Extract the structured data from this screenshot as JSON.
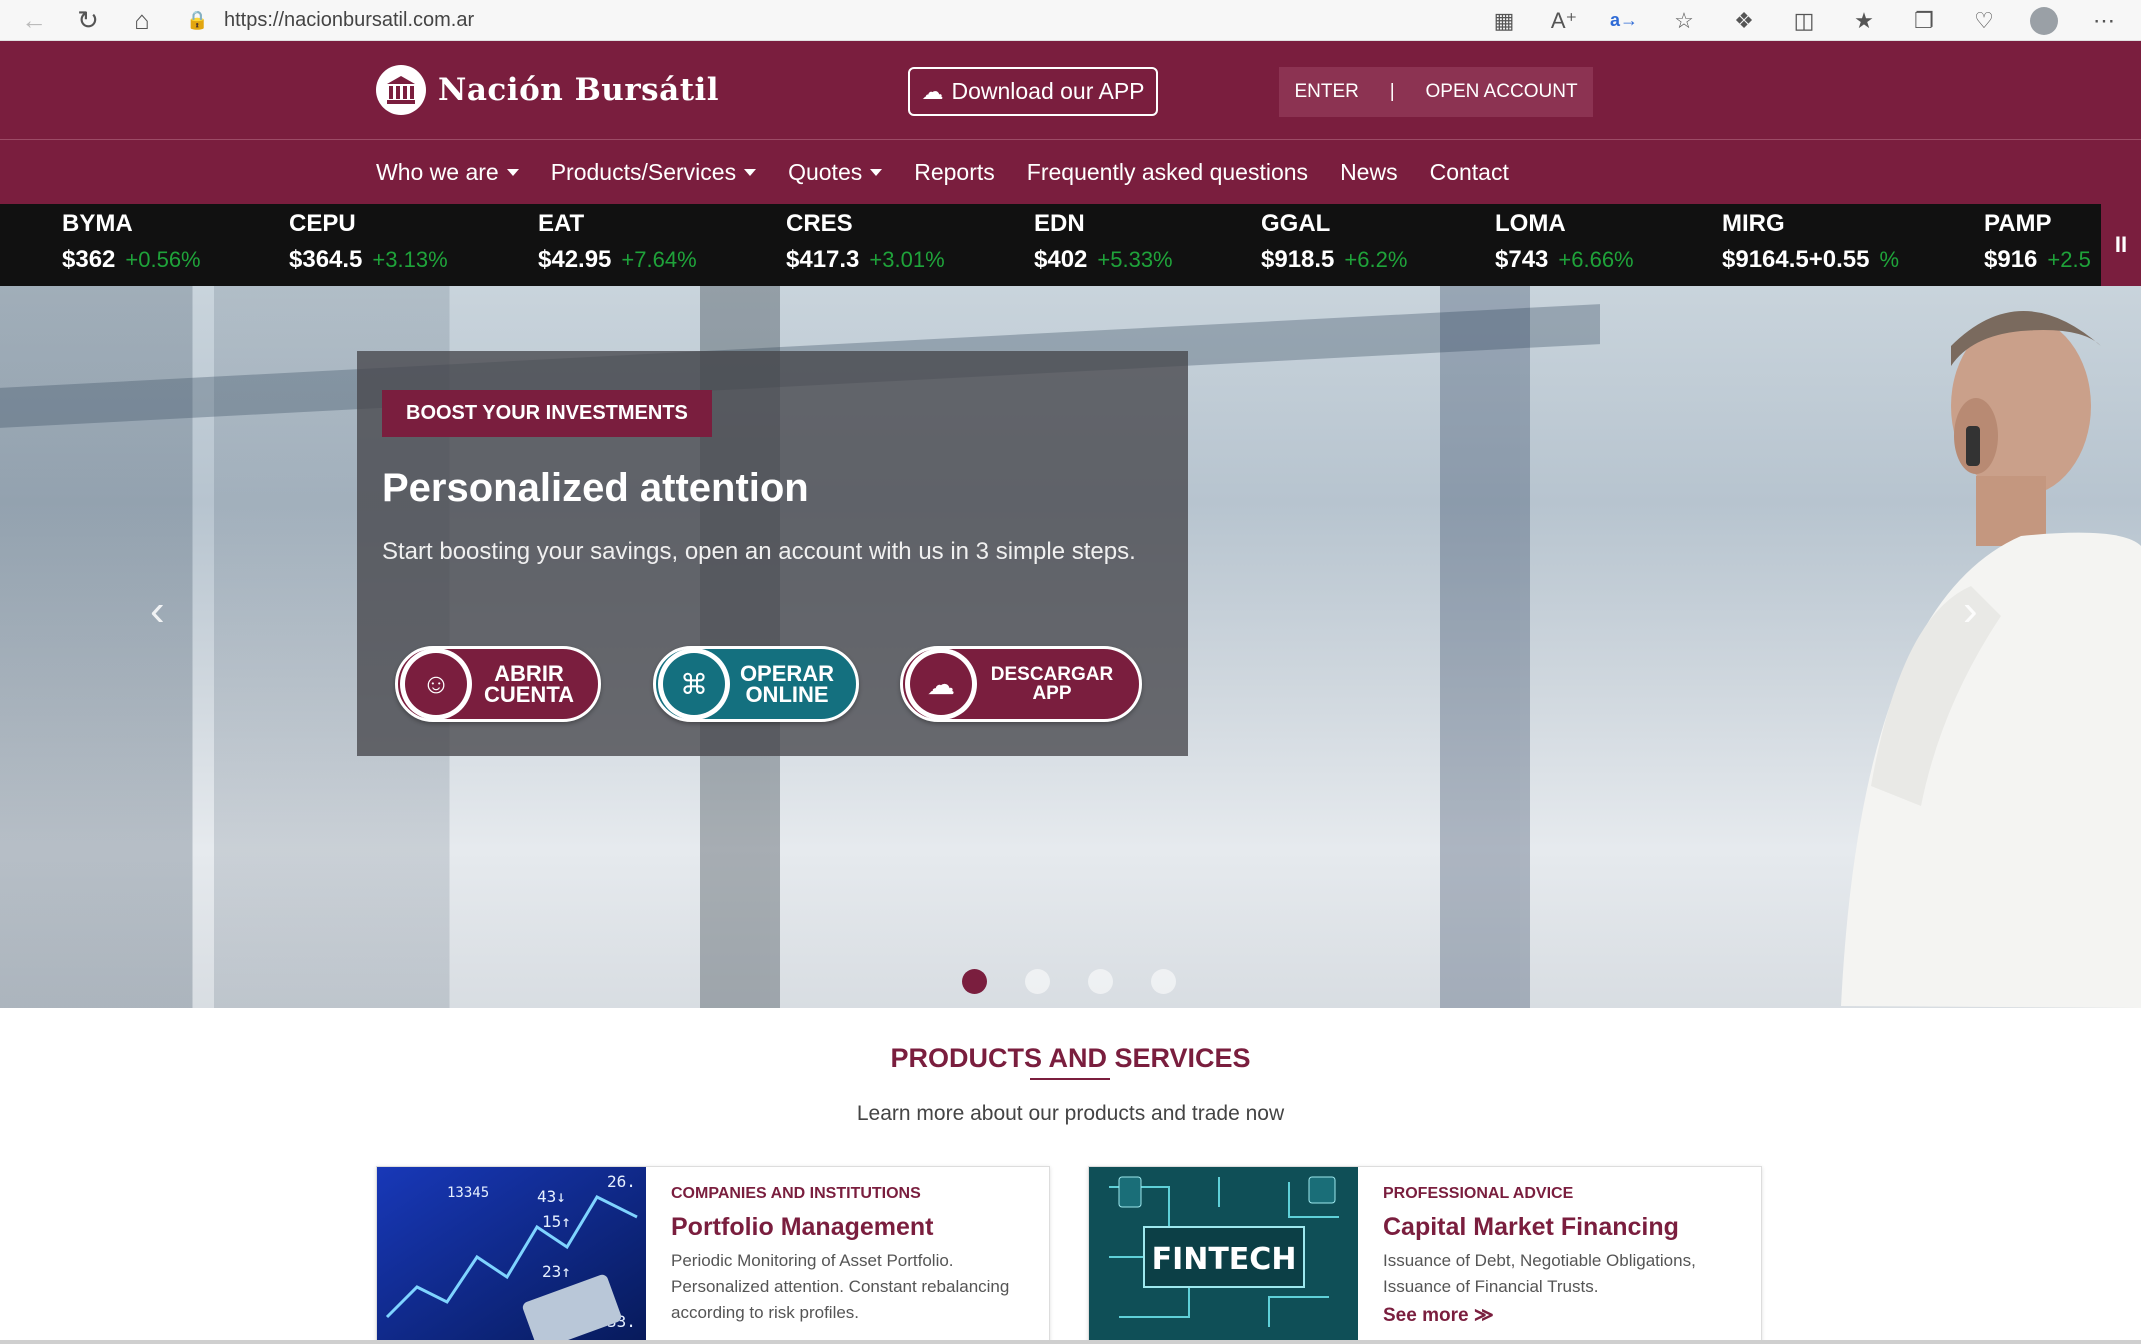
{
  "browser": {
    "url": "https://nacionbursatil.com.ar"
  },
  "header": {
    "brand": "Nación Bursátil",
    "download_app": "Download our APP",
    "enter": "ENTER",
    "separator": "|",
    "open_account": "OPEN ACCOUNT"
  },
  "nav": {
    "items": [
      {
        "label": "Who we are",
        "dropdown": true
      },
      {
        "label": "Products/Services",
        "dropdown": true
      },
      {
        "label": "Quotes",
        "dropdown": true
      },
      {
        "label": "Reports",
        "dropdown": false
      },
      {
        "label": "Frequently asked questions",
        "dropdown": false
      },
      {
        "label": "News",
        "dropdown": false
      },
      {
        "label": "Contact",
        "dropdown": false
      }
    ]
  },
  "ticker": [
    {
      "symbol": "BYMA",
      "price": "$362",
      "change": "+0.56%"
    },
    {
      "symbol": "CEPU",
      "price": "$364.5",
      "change": "+3.13%"
    },
    {
      "symbol": "EAT",
      "price": "$42.95",
      "change": "+7.64%"
    },
    {
      "symbol": "CRES",
      "price": "$417.3",
      "change": "+3.01%"
    },
    {
      "symbol": "EDN",
      "price": "$402",
      "change": "+5.33%"
    },
    {
      "symbol": "GGAL",
      "price": "$918.5",
      "change": "+6.2%"
    },
    {
      "symbol": "LOMA",
      "price": "$743",
      "change": "+6.66%"
    },
    {
      "symbol": "MIRG",
      "price": "$9164.5+0.55",
      "change": "%"
    },
    {
      "symbol": "PAMP",
      "price": "$916",
      "change": "+2.5"
    }
  ],
  "ticker_pause": "II",
  "hero": {
    "badge": "BOOST YOUR INVESTMENTS",
    "title": "Personalized attention",
    "text": "Start boosting your savings, open an account with us in 3 simple steps.",
    "buttons": {
      "abrir_line1": "ABRIR",
      "abrir_line2": "CUENTA",
      "operar_line1": "OPERAR",
      "operar_line2": "ONLINE",
      "descargar_line1": "DESCARGAR",
      "descargar_line2": "APP"
    },
    "active_slide": 1,
    "slide_count": 4
  },
  "products": {
    "title": "PRODUCTS AND SERVICES",
    "subtitle": "Learn more about our products and trade now",
    "cards": [
      {
        "category": "COMPANIES AND INSTITUTIONS",
        "title": "Portfolio Management",
        "description": "Periodic Monitoring of Asset Portfolio. Personalized attention. Constant rebalancing according to risk profiles."
      },
      {
        "category": "PROFESSIONAL ADVICE",
        "title": "Capital Market Financing",
        "description": "Issuance of Debt, Negotiable Obligations, Issuance of Financial Trusts.",
        "link": "See more ≫"
      }
    ],
    "card2_image_text": "FINTECH"
  },
  "colors": {
    "brand": "#7a1e3e",
    "ticker_bg": "#111111",
    "positive": "#1fa33a",
    "teal": "#14707f"
  }
}
